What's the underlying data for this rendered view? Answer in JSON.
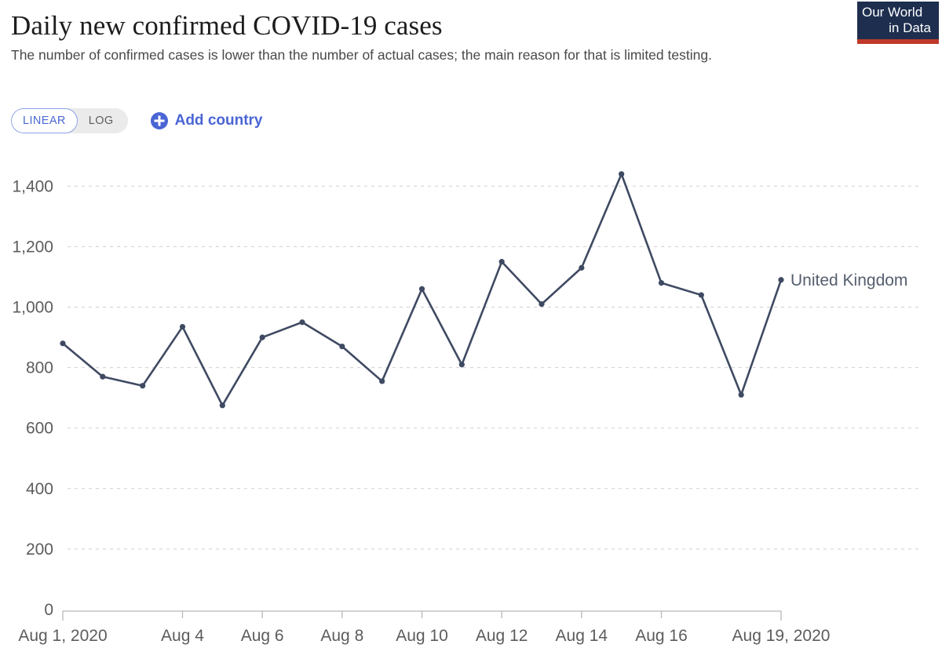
{
  "header": {
    "title": "Daily new confirmed COVID-19 cases",
    "subtitle": "The number of confirmed cases is lower than the number of actual cases; the main reason for that is limited testing."
  },
  "logo": {
    "line1": "Our World",
    "line2": "in Data",
    "bg_color": "#1d2e4e",
    "stripe_color": "#c0392b"
  },
  "controls": {
    "scale_toggle": {
      "options": [
        "LINEAR",
        "LOG"
      ],
      "selected": "LINEAR",
      "selected_color": "#4b68d6"
    },
    "add_country_label": "Add country",
    "add_country_color": "#4a65d4"
  },
  "chart_data": {
    "type": "line",
    "title": "Daily new confirmed COVID-19 cases",
    "subtitle": "The number of confirmed cases is lower than the number of actual cases; the main reason for that is limited testing.",
    "xlabel": "",
    "ylabel": "",
    "ylim": [
      0,
      1450
    ],
    "yticks": [
      0,
      200,
      400,
      600,
      800,
      1000,
      1200,
      1400
    ],
    "ytick_labels": [
      "0",
      "200",
      "400",
      "600",
      "800",
      "1,000",
      "1,200",
      "1,400"
    ],
    "xticks": [
      "Aug 1, 2020",
      "Aug 4",
      "Aug 6",
      "Aug 8",
      "Aug 10",
      "Aug 12",
      "Aug 14",
      "Aug 16",
      "Aug 19, 2020"
    ],
    "xtick_values": [
      1,
      4,
      6,
      8,
      10,
      12,
      14,
      16,
      19
    ],
    "x": [
      1,
      2,
      3,
      4,
      5,
      6,
      7,
      8,
      9,
      10,
      11,
      12,
      13,
      14,
      15,
      16,
      17,
      18,
      19
    ],
    "x_labels": [
      "Aug 1",
      "Aug 2",
      "Aug 3",
      "Aug 4",
      "Aug 5",
      "Aug 6",
      "Aug 7",
      "Aug 8",
      "Aug 9",
      "Aug 10",
      "Aug 11",
      "Aug 12",
      "Aug 13",
      "Aug 14",
      "Aug 15",
      "Aug 16",
      "Aug 17",
      "Aug 18",
      "Aug 19"
    ],
    "grid": true,
    "grid_axis": "y",
    "legend_position": "right-end-label",
    "series": [
      {
        "name": "United Kingdom",
        "color": "#3f4a62",
        "values": [
          880,
          770,
          740,
          935,
          675,
          900,
          950,
          870,
          755,
          1060,
          810,
          1150,
          1010,
          1130,
          1440,
          1080,
          1040,
          710,
          1090
        ]
      }
    ]
  }
}
